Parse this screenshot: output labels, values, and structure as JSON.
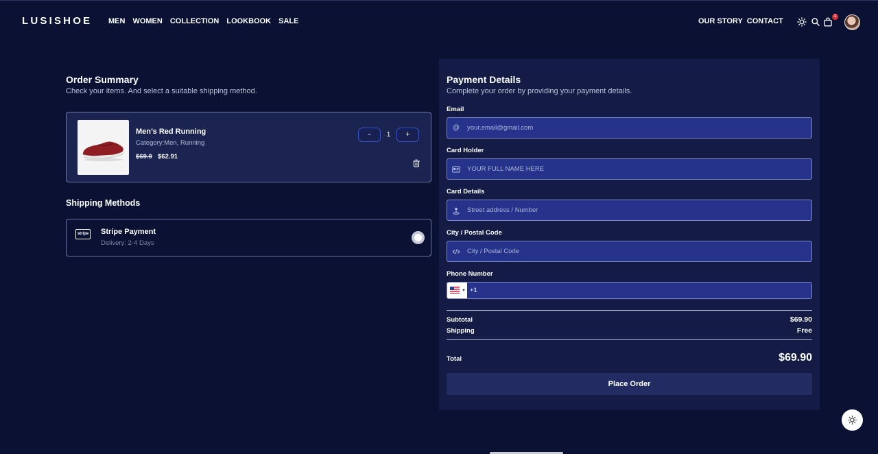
{
  "header": {
    "logo": "LUSISHOE",
    "nav_left": [
      "MEN",
      "WOMEN",
      "COLLECTION",
      "LOOKBOOK",
      "SALE"
    ],
    "nav_right": [
      "OUR STORY",
      "CONTACT"
    ],
    "icons": [
      "sun-icon",
      "search-icon",
      "bag-icon",
      "avatar"
    ],
    "cart_count": "1"
  },
  "order_summary": {
    "title": "Order Summary",
    "subtitle": "Check your items. And select a suitable shipping method.",
    "item": {
      "name": "Men’s Red Running",
      "category": "Category:Men, Running",
      "price_old": "$69.9",
      "price_new": "$62.91",
      "minus": "-",
      "quantity": "1",
      "plus": "+"
    }
  },
  "shipping": {
    "title": "Shipping Methods",
    "method": {
      "logo": "stripe",
      "name": "Stripe Payment",
      "delivery": "Delivery: 2-4 Days"
    }
  },
  "payment": {
    "title": "Payment Details",
    "subtitle": "Complete your order by providing your payment details.",
    "email_label": "Email",
    "email_placeholder": "your.email@gmail.com",
    "holder_label": "Card Holder",
    "holder_placeholder": "YOUR FULL NAME HERE",
    "card_label": "Card Details",
    "card_placeholder": "Street address / Number",
    "city_label": "City / Postal Code",
    "city_placeholder": "City / Postal Code",
    "phone_label": "Phone Number",
    "phone_value": "+1",
    "subtotal_label": "Subtotal",
    "subtotal_value": "$69.90",
    "shipping_label": "Shipping",
    "shipping_value": "Free",
    "total_label": "Total",
    "total_value": "$69.90",
    "place_order": "Place Order"
  },
  "colors": {
    "background": "#0b1133",
    "panel": "#141c46",
    "input": "#26338a",
    "accent_border": "#3552c9"
  }
}
